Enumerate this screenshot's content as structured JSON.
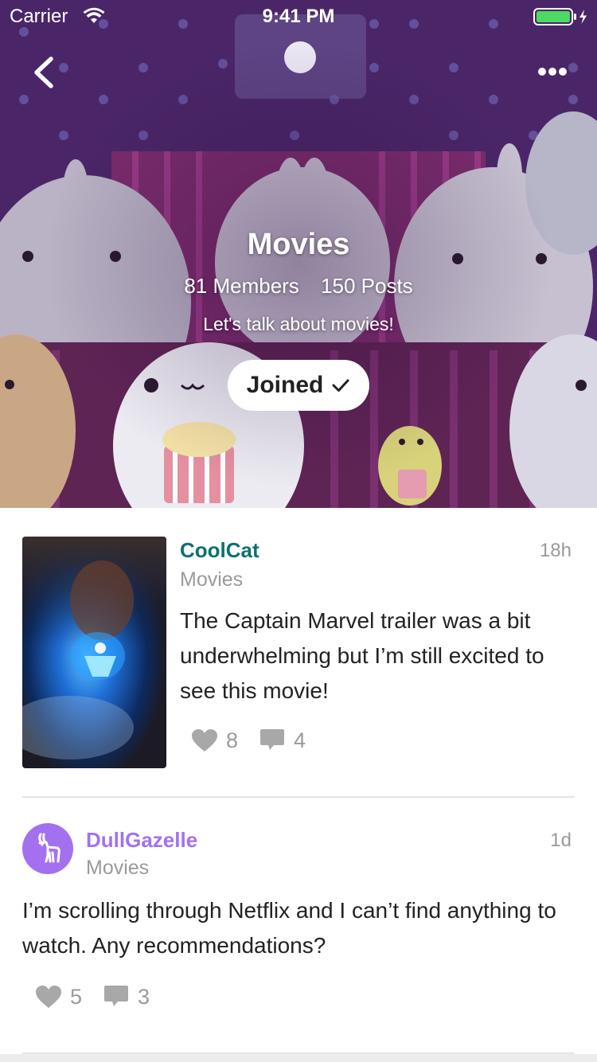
{
  "status_bar": {
    "carrier": "Carrier",
    "time": "9:41 PM",
    "wifi_icon": "wifi-icon",
    "battery_icon": "battery-charging-icon"
  },
  "nav": {
    "back_icon": "chevron-left-icon",
    "more_icon": "more-horizontal-icon"
  },
  "group": {
    "name": "Movies",
    "members": "81 Members",
    "posts": "150 Posts",
    "description": "Let's talk about movies!",
    "join_label": "Joined",
    "join_icon": "checkmark-icon"
  },
  "feed": [
    {
      "author": "CoolCat",
      "author_color": "#0e6f70",
      "group": "Movies",
      "time": "18h",
      "text": "The Captain Marvel trailer was a bit underwhelming but I’m still excited to see this movie!",
      "likes": "8",
      "comments": "4",
      "media": "captain-marvel-thumbnail"
    },
    {
      "author": "DullGazelle",
      "author_color": "#a371f0",
      "avatar_icon": "gazelle-icon",
      "group": "Movies",
      "time": "1d",
      "text": "I’m scrolling through Netflix and I can’t find anything to watch. Any recommendations?",
      "likes": "5",
      "comments": "3"
    }
  ],
  "icons": {
    "like": "heart-icon",
    "comment": "comment-icon"
  },
  "colors": {
    "hero_bg": "#4a2466",
    "meta_gray": "#9a9a9a",
    "icon_gray": "#a8a8a8"
  }
}
